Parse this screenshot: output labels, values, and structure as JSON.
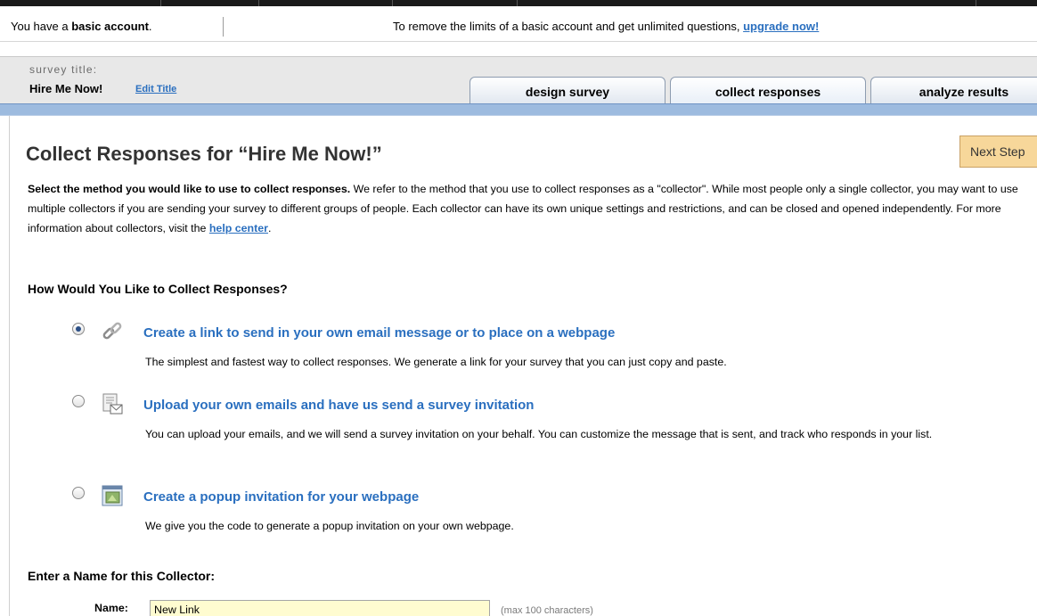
{
  "account_bar": {
    "prefix": "You have a ",
    "account_type": "basic account",
    "suffix": ".",
    "upgrade_prefix": "To remove the limits of a basic account and get unlimited questions, ",
    "upgrade_link": "upgrade now!"
  },
  "survey_header": {
    "label": "survey title:",
    "title": "Hire Me Now!",
    "edit_link": "Edit Title"
  },
  "tabs": [
    {
      "label": "design survey"
    },
    {
      "label": "collect responses"
    },
    {
      "label": "analyze results"
    }
  ],
  "page": {
    "title": "Collect Responses for “Hire Me Now!”",
    "next_button": "Next Step",
    "intro_bold": "Select the method you would like to use to collect responses.",
    "intro_text": "  We refer to the method that you use to collect responses as a \"collector\". While most people only a single collector, you may want to use multiple collectors if you are sending your survey to different groups of people. Each collector can have its own unique settings and restrictions, and can be closed and opened independently.  For more information about collectors, visit the ",
    "help_link": "help center",
    "intro_end": "."
  },
  "methods_heading": "How Would You Like to Collect Responses?",
  "methods": [
    {
      "icon": "link-icon",
      "selected": true,
      "title": "Create a link to send in your own email message or to place on a webpage",
      "description": "The simplest and fastest way to collect responses. We generate a link for your survey that you can just copy and paste."
    },
    {
      "icon": "email-list-icon",
      "selected": false,
      "title": "Upload your own emails and have us send a survey invitation",
      "description": "You can upload your emails, and we will send a survey invitation on your behalf. You can customize the message that is sent, and track who responds in your list."
    },
    {
      "icon": "popup-window-icon",
      "selected": false,
      "title": "Create a popup invitation for your webpage",
      "description": "We give you the code to generate a popup invitation on your own webpage."
    }
  ],
  "collector_name": {
    "heading": "Enter a Name for this Collector:",
    "label": "Name:",
    "value": "New Link",
    "hint": "(max 100 characters)"
  },
  "colors": {
    "link": "#2a6fbf",
    "tab_bar": "#9dbbdf",
    "next_button": "#f7d79a",
    "input_bg": "#fffcd0"
  }
}
